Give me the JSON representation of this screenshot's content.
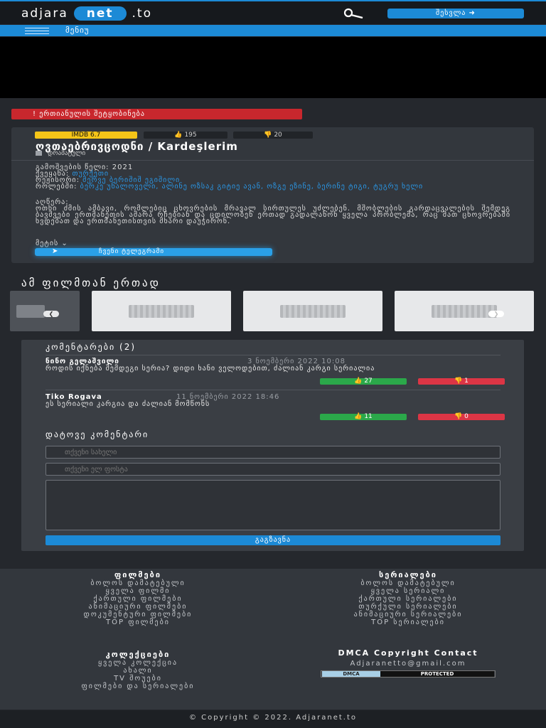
{
  "header": {
    "logo_left": "adjara",
    "logo_pill": "net",
    "logo_right": ".to",
    "login_label": "შესვლა ➜"
  },
  "nav": {
    "menu_label": "მენიუ"
  },
  "alert": {
    "label": "! ერთიანულის შეტყობინება"
  },
  "movie": {
    "imdb": "IMDB 6.7",
    "likes": "195",
    "dislikes": "20",
    "title": "ღვთაებრივცოდნი / Kardeşlerim",
    "genre": "დრამატული",
    "meta": [
      {
        "label": "გამოშვების წელი:",
        "value": "2021",
        "type": "text"
      },
      {
        "label": "ქვეყანა:",
        "value": "თურქეთი",
        "type": "link"
      },
      {
        "label": "რეჟისორი:",
        "value": "მერვე ბერიშიშ ეგიშილი",
        "type": "link"
      },
      {
        "label": "როლებში:",
        "value": "ბერკე უნალოველი, ალინე ოზსაკ გიტიე ავან, ოზგე ეზინე, ბერინე ტიგი, ტუგრუ ხელი",
        "type": "link"
      }
    ],
    "desc_label": "აღწერა:",
    "description": "ოთხი ძმის ამბავი, რომლებიც ცხოვრების მრავალ სირთულეს უძლებენ. მშობლების გარდაცვალების შემდეგ ბავშვები ერთმანეთის ამარა რჩებიან და ცდილობენ ერთად გადალახონ ყველა პრობლემა, რაც მათ ცხოვრებაში ხვდებათ და ერთმანეთისთვის მხარი დაუჭირონ.",
    "more_label": "მეტის ⌄",
    "telegram_label": "ჩვენი ტელეგრამი"
  },
  "similar": {
    "title": "ამ ფილმთან ერთად"
  },
  "comments": {
    "title": "კომენტარები (2)",
    "items": [
      {
        "author": "ნინო გელაშვილი",
        "date": "3 ნოემბერი 2022 10:08",
        "text": "როდის იქნება შემდეგი სერია? დიდი ხანი ველოდებით, ძალიან კარგი სერიალია",
        "likes": "27",
        "dislikes": "1"
      },
      {
        "author": "Tiko Rogava",
        "date": "11 ნოემბერი 2022 18:46",
        "text": "ეს სერიალი კარგია და ძალიან მომწონს",
        "likes": "11",
        "dislikes": "0"
      }
    ],
    "add_title": "დატოვე კომენტარი",
    "name_placeholder": "თქვენი სახელი",
    "email_placeholder": "თქვენი ელ ფოსტა",
    "submit_label": "გაგზავნა"
  },
  "footer": {
    "films_head": "ფილმები",
    "films_links": [
      "ბოლოს დამატებული",
      "ყველა ფილმი",
      "ქართული ფილმები",
      "ანიმაციური ფილმები",
      "დოკუმენტური ფილმები",
      "TOP ფილმები"
    ],
    "series_head": "სერიალები",
    "series_links": [
      "ბოლოს დამატებული",
      "ყველა სერიალი",
      "ქართული სერიალები",
      "თურქული სერიალები",
      "ანიმაციური სერიალები",
      "TOP სერიალები"
    ],
    "collections_head": "კოლექციები",
    "collections_links": [
      "ყველა კოლექცია",
      "ახალი",
      "TV შოუები",
      "ფილმები და სერიალები"
    ],
    "dmca_head": "DMCA Copyright Contact",
    "email": "Adjaranetto@gmail.com",
    "dmca_left": "DMCA",
    "dmca_right": "PROTECTED",
    "copyright": "© Copyright © 2022. Adjaranet.to"
  },
  "colors": {
    "accent": "#1c8ad6",
    "alert": "#c8272d",
    "imdb": "#f5c518",
    "like": "#2ba84a",
    "dislike": "#dc3545"
  }
}
